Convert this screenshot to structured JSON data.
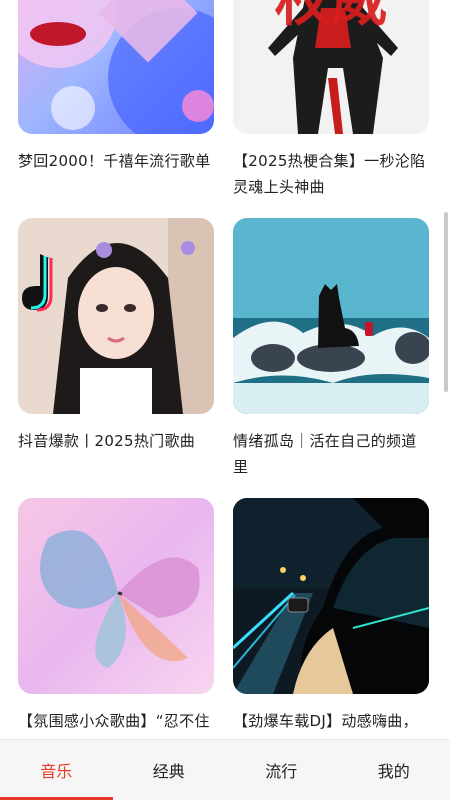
{
  "cards": [
    {
      "title": "梦回2000！千禧年流行歌单"
    },
    {
      "title": "【2025热梗合集】一秒沦陷灵魂上头神曲",
      "cover_text": "权威"
    },
    {
      "title": "抖音爆款丨2025热门歌曲"
    },
    {
      "title": "情绪孤岛｜活在自己的频道里"
    },
    {
      "title": "【氛围感小众歌曲】“忍不住单曲循环！”"
    },
    {
      "title": "【劲爆车载DJ】动感嗨曲，一脚踩进油箱超"
    }
  ],
  "tabs": [
    {
      "label": "音乐",
      "active": true
    },
    {
      "label": "经典",
      "active": false
    },
    {
      "label": "流行",
      "active": false
    },
    {
      "label": "我的",
      "active": false
    }
  ],
  "colors": {
    "accent": "#e8382b"
  }
}
